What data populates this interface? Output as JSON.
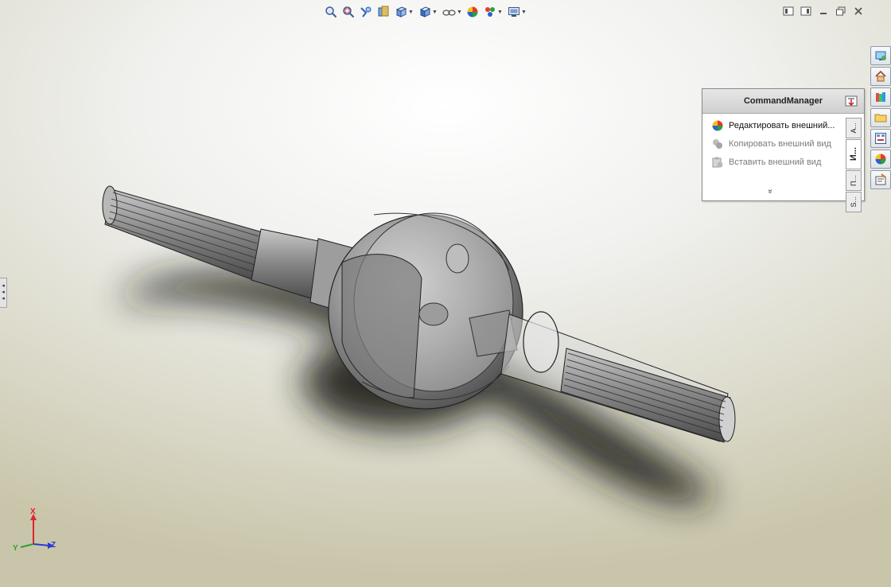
{
  "hud_toolbar": {
    "buttons": [
      {
        "icon": "zoom-to-fit-icon"
      },
      {
        "icon": "zoom-to-area-icon"
      },
      {
        "icon": "previous-view-icon"
      },
      {
        "icon": "section-view-icon"
      },
      {
        "icon": "view-orientation-icon",
        "dropdown": true
      },
      {
        "icon": "display-style-icon",
        "dropdown": true
      },
      {
        "icon": "hide-show-items-icon",
        "dropdown": true
      },
      {
        "icon": "edit-appearance-icon"
      },
      {
        "icon": "apply-scene-icon",
        "dropdown": true
      },
      {
        "icon": "view-settings-icon",
        "dropdown": true
      }
    ]
  },
  "window_controls": [
    "tile-left-icon",
    "tile-right-icon",
    "minimize-icon",
    "restore-icon",
    "close-icon"
  ],
  "task_pane": {
    "buttons": [
      "resources-icon",
      "home-icon",
      "design-library-icon",
      "file-explorer-icon",
      "view-palette-icon",
      "appearances-icon",
      "custom-properties-icon"
    ]
  },
  "command_manager": {
    "title": "CommandManager",
    "items": [
      {
        "label": "Редактировать внешний...",
        "icon": "edit-appearance-icon",
        "enabled": true
      },
      {
        "label": "Копировать внешний вид",
        "icon": "copy-appearance-icon",
        "enabled": false
      },
      {
        "label": "Вставить внешний вид",
        "icon": "paste-appearance-icon",
        "enabled": false
      }
    ],
    "tabs": [
      {
        "label": "А..."
      },
      {
        "label": "И..."
      },
      {
        "label": "П..."
      },
      {
        "label": "S..."
      }
    ],
    "active_tab": 1,
    "more_glyph": "»"
  },
  "triad": {
    "x": "X",
    "y": "Y",
    "z": "Z"
  },
  "colors": {
    "x_axis": "#e0242b",
    "y_axis": "#2fa12f",
    "z_axis": "#2b3bcf"
  }
}
